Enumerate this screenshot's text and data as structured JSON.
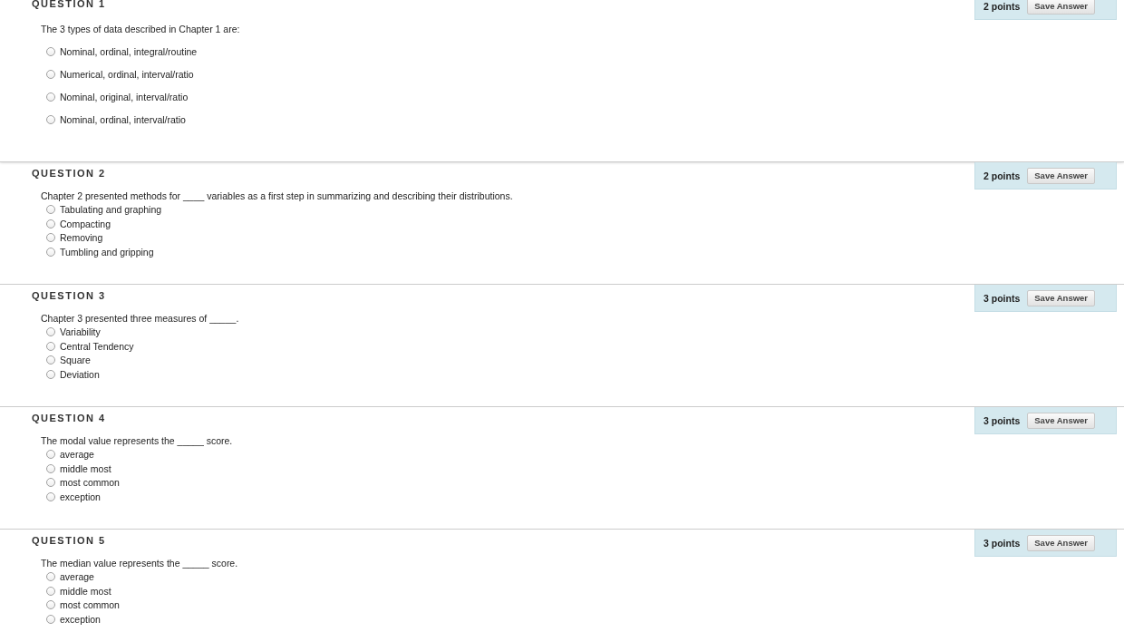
{
  "questions": [
    {
      "title": "QUESTION 1",
      "points": "2 points",
      "button": "Save Answer",
      "kind": "spaced",
      "text": "The 3 types of data described in Chapter 1 are:",
      "options": [
        {
          "label": "Nominal, ordinal, integral/routine",
          "selected": false
        },
        {
          "label": "Numerical, ordinal, interval/ratio",
          "selected": false
        },
        {
          "label": "Nominal, original, interval/ratio",
          "selected": false
        },
        {
          "label": "Nominal, ordinal, interval/ratio",
          "selected": false
        }
      ]
    },
    {
      "title": "QUESTION 2",
      "points": "2 points",
      "button": "Save Answer",
      "kind": "compact",
      "text": "Chapter 2 presented methods for ____ variables as a first step in summarizing and describing their distributions.",
      "options": [
        {
          "label": "Tabulating and graphing",
          "selected": false
        },
        {
          "label": "Compacting",
          "selected": false
        },
        {
          "label": "Removing",
          "selected": false
        },
        {
          "label": "Tumbling and gripping",
          "selected": false
        }
      ]
    },
    {
      "title": "QUESTION 3",
      "points": "3 points",
      "button": "Save Answer",
      "kind": "compact",
      "text": "Chapter 3 presented three measures of _____.",
      "options": [
        {
          "label": "Variability",
          "selected": false
        },
        {
          "label": "Central Tendency",
          "selected": false
        },
        {
          "label": "Square",
          "selected": false
        },
        {
          "label": "Deviation",
          "selected": false
        }
      ]
    },
    {
      "title": "QUESTION 4",
      "points": "3 points",
      "button": "Save Answer",
      "kind": "compact",
      "text": "The modal value represents the _____ score.",
      "options": [
        {
          "label": "average",
          "selected": false
        },
        {
          "label": "middle most",
          "selected": false
        },
        {
          "label": "most common",
          "selected": false
        },
        {
          "label": "exception",
          "selected": false
        }
      ]
    },
    {
      "title": "QUESTION 5",
      "points": "3 points",
      "button": "Save Answer",
      "kind": "compact",
      "text": "The median value represents the _____ score.",
      "options": [
        {
          "label": "average",
          "selected": false
        },
        {
          "label": "middle most",
          "selected": false
        },
        {
          "label": "most common",
          "selected": false
        },
        {
          "label": "exception",
          "selected": false
        }
      ]
    }
  ]
}
